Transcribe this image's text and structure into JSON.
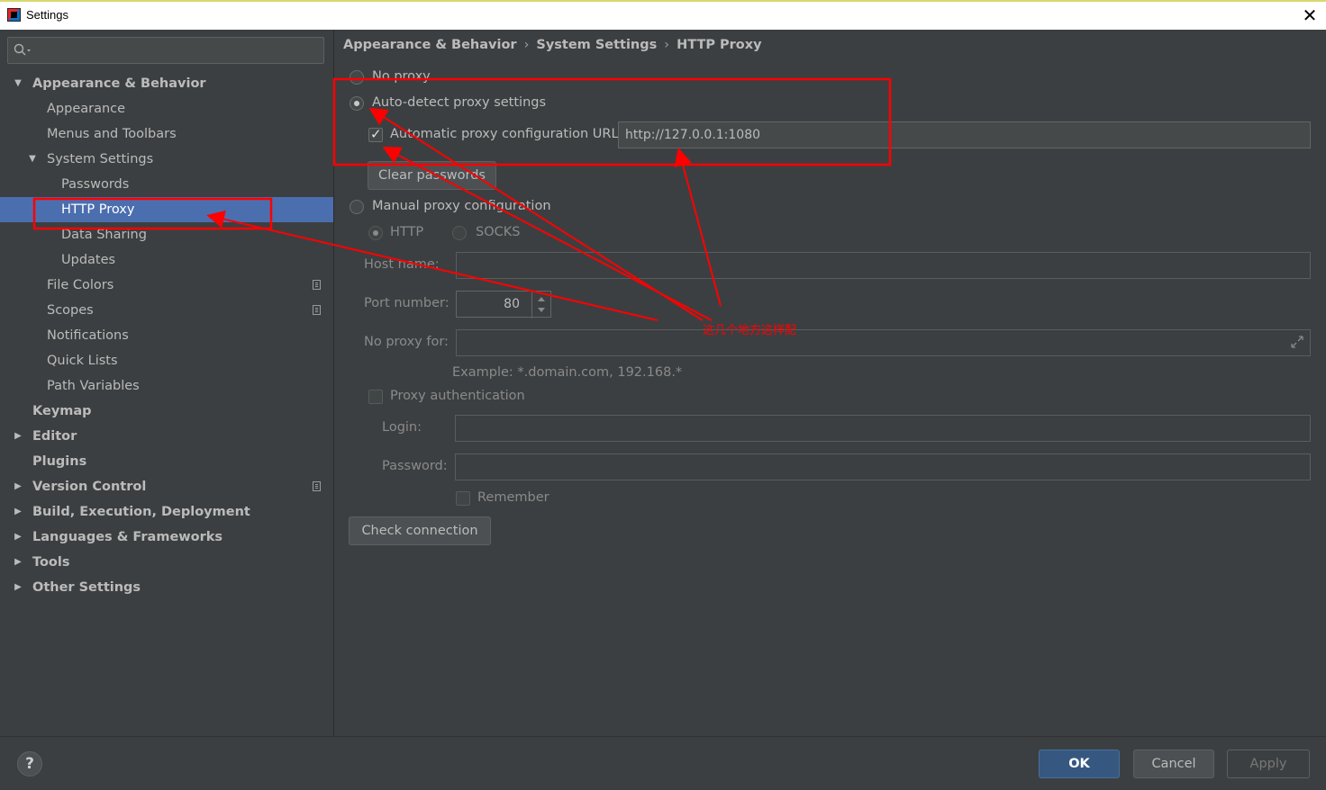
{
  "window": {
    "title": "Settings",
    "close_glyph": "✕"
  },
  "sidebar": {
    "items": [
      {
        "label": "Appearance & Behavior",
        "expanded": true
      },
      {
        "label": "Appearance"
      },
      {
        "label": "Menus and Toolbars"
      },
      {
        "label": "System Settings",
        "expanded": true
      },
      {
        "label": "Passwords"
      },
      {
        "label": "HTTP Proxy",
        "selected": true
      },
      {
        "label": "Data Sharing"
      },
      {
        "label": "Updates"
      },
      {
        "label": "File Colors",
        "badge": "copy-icon"
      },
      {
        "label": "Scopes",
        "badge": "copy-icon"
      },
      {
        "label": "Notifications"
      },
      {
        "label": "Quick Lists"
      },
      {
        "label": "Path Variables"
      },
      {
        "label": "Keymap"
      },
      {
        "label": "Editor",
        "expanded": false
      },
      {
        "label": "Plugins"
      },
      {
        "label": "Version Control",
        "expanded": false,
        "badge": "copy-icon"
      },
      {
        "label": "Build, Execution, Deployment",
        "expanded": false
      },
      {
        "label": "Languages & Frameworks",
        "expanded": false
      },
      {
        "label": "Tools",
        "expanded": false
      },
      {
        "label": "Other Settings",
        "expanded": false
      }
    ]
  },
  "breadcrumb": {
    "part1": "Appearance & Behavior",
    "part2": "System Settings",
    "part3": "HTTP Proxy",
    "separator": "›"
  },
  "proxy": {
    "no_proxy_label": "No proxy",
    "auto_detect_label": "Auto-detect proxy settings",
    "selected_mode": "auto-detect",
    "auto_config_label": "Automatic proxy configuration URL:",
    "auto_config_checked": true,
    "auto_config_url": "http://127.0.0.1:1080",
    "clear_passwords_label": "Clear passwords",
    "manual_label": "Manual proxy configuration",
    "http_label": "HTTP",
    "socks_label": "SOCKS",
    "host_label": "Host name:",
    "host_value": "",
    "port_label": "Port number:",
    "port_value": "80",
    "no_proxy_for_label": "No proxy for:",
    "no_proxy_for_value": "",
    "example_text": "Example: *.domain.com, 192.168.*",
    "auth_label": "Proxy authentication",
    "auth_checked": false,
    "login_label": "Login:",
    "login_value": "",
    "password_label": "Password:",
    "password_value": "",
    "remember_label": "Remember",
    "check_connection_label": "Check connection"
  },
  "annotation": {
    "note": "这几个地方这样配",
    "color": "#ff0000"
  },
  "footer": {
    "help_label": "?",
    "ok_label": "OK",
    "cancel_label": "Cancel",
    "apply_label": "Apply"
  },
  "colors": {
    "selected": "#4b6eaf",
    "background": "#3c3f41",
    "ok": "#365880"
  }
}
